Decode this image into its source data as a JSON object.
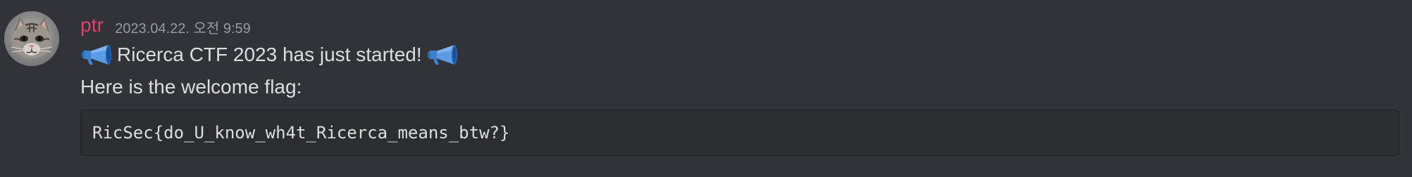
{
  "message": {
    "author": {
      "username": "ptr",
      "username_color": "#e0436f",
      "avatar": "cat-avatar"
    },
    "timestamp": "2023.04.22. 오전 9:59",
    "lines": [
      {
        "prefix_icon": "megaphone-icon",
        "text": "Ricerca CTF 2023 has just started!",
        "suffix_icon": "megaphone-icon"
      },
      {
        "text": "Here is the welcome flag:"
      }
    ],
    "code_block": {
      "content": "RicSec{do_U_know_wh4t_Ricerca_means_btw?}"
    }
  },
  "colors": {
    "background": "#313338",
    "code_background": "#2b2d31",
    "text": "#dbdee1",
    "timestamp": "#949ba4"
  }
}
